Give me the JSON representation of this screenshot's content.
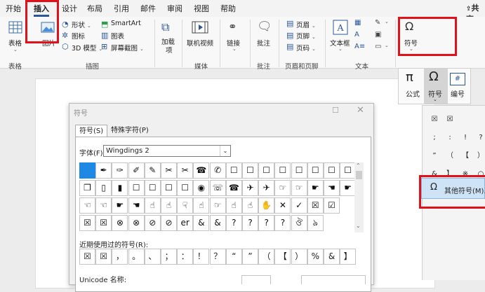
{
  "tabs": [
    "开始",
    "插入",
    "设计",
    "布局",
    "引用",
    "邮件",
    "审阅",
    "视图",
    "帮助"
  ],
  "active_tab": "插入",
  "share_label": "共享",
  "ribbon": {
    "table": "表格",
    "picture": "图片",
    "shapes": "形状",
    "icons": "图标",
    "model3d": "3D 模型",
    "smartart": "SmartArt",
    "chart": "图表",
    "screenshot": "屏幕截图",
    "addins": "加载\n项",
    "addins_l1": "加载",
    "addins_l2": "项",
    "online_video": "联机视频",
    "link": "链接",
    "comment": "批注",
    "header": "页眉",
    "footer": "页脚",
    "page_number": "页码",
    "textbox": "文本框",
    "symbol": "符号",
    "groups": {
      "table": "表格",
      "illustrations": "插图",
      "media": "媒体",
      "comments": "批注",
      "header_footer": "页眉和页脚",
      "text": "文本"
    }
  },
  "symbol_submenu": {
    "equation": "公式",
    "symbol": "符号",
    "number": "编号"
  },
  "gallery": {
    "rows": [
      [
        "☒",
        "☒",
        "",
        ""
      ],
      [
        ";",
        ":",
        "!",
        "?"
      ],
      [
        "”",
        "（",
        "【",
        "）"
      ],
      [
        "&",
        "】",
        "※",
        "○"
      ]
    ],
    "more_label": "其他符号(M)..."
  },
  "dialog": {
    "title": "符号",
    "tab_symbols": "符号(S)",
    "tab_special": "特殊字符(P)",
    "font_label": "字体(F):",
    "font_value": "Wingdings 2",
    "grid": [
      [
        "",
        "✒",
        "✑",
        "✐",
        "✎",
        "✂",
        "✂",
        "☎",
        "✆",
        "☐",
        "☐",
        "☐",
        "☐",
        "☐",
        "☐",
        "☐",
        "☐"
      ],
      [
        "❐",
        "▯",
        "▮",
        "☐",
        "☐",
        "☐",
        "☐",
        "◉",
        "☏",
        "☎",
        "✈",
        "✈",
        "☞",
        "☞",
        "☛",
        "☚",
        "☛"
      ],
      [
        "☜",
        "☜",
        "☛",
        "☚",
        "☝",
        "☝",
        "☟",
        "☝",
        "☞",
        "☝",
        "☝",
        "✋",
        "✕",
        "✓",
        "☒",
        "☑"
      ],
      [
        "☒",
        "☒",
        "⊗",
        "⊗",
        "⊘",
        "⊘",
        "er",
        "&",
        "&",
        "?",
        "?",
        "?",
        "?",
        "ঔ",
        "ঌ"
      ]
    ],
    "recent_label": "近期使用过的符号(R):",
    "recent": [
      "☒",
      "☒",
      "，",
      "。",
      "、",
      "；",
      "：",
      "！",
      "？",
      "“",
      "”",
      "（",
      "【",
      "）",
      "%",
      "&",
      "】"
    ],
    "unicode_label": "Unicode 名称:"
  },
  "colors": {
    "accent": "#2b5797",
    "highlight": "#e1111c",
    "selected": "#1e88e5"
  }
}
